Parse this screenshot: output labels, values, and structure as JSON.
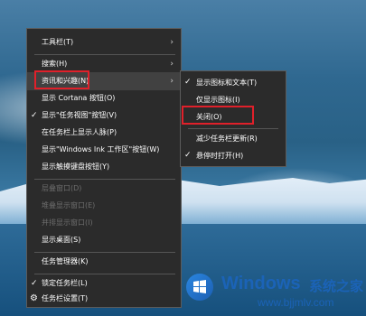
{
  "menu": {
    "items": [
      {
        "label": "工具栏(T)"
      },
      {
        "label": "搜索(H)"
      },
      {
        "label": "资讯和兴趣(N)"
      },
      {
        "label": "显示 Cortana 按钮(O)"
      },
      {
        "label": "显示\"任务视图\"按钮(V)"
      },
      {
        "label": "在任务栏上显示人脉(P)"
      },
      {
        "label": "显示\"Windows Ink 工作区\"按钮(W)"
      },
      {
        "label": "显示触摸键盘按钮(Y)"
      },
      {
        "label": "层叠窗口(D)"
      },
      {
        "label": "堆叠显示窗口(E)"
      },
      {
        "label": "并排显示窗口(I)"
      },
      {
        "label": "显示桌面(S)"
      },
      {
        "label": "任务管理器(K)"
      },
      {
        "label": "锁定任务栏(L)"
      },
      {
        "label": "任务栏设置(T)"
      }
    ]
  },
  "submenu": {
    "items": [
      {
        "label": "显示图标和文本(T)"
      },
      {
        "label": "仅显示图标(I)"
      },
      {
        "label": "关闭(O)"
      },
      {
        "label": "减少任务栏更新(R)"
      },
      {
        "label": "悬停时打开(H)"
      }
    ]
  },
  "watermark": {
    "brand": "Windows",
    "cn": "系统之家",
    "url": "www.bjjmlv.com"
  },
  "colors": {
    "menu_bg": "#2b2b2b",
    "highlight_box": "#e0202a",
    "watermark": "#1b63b7"
  }
}
